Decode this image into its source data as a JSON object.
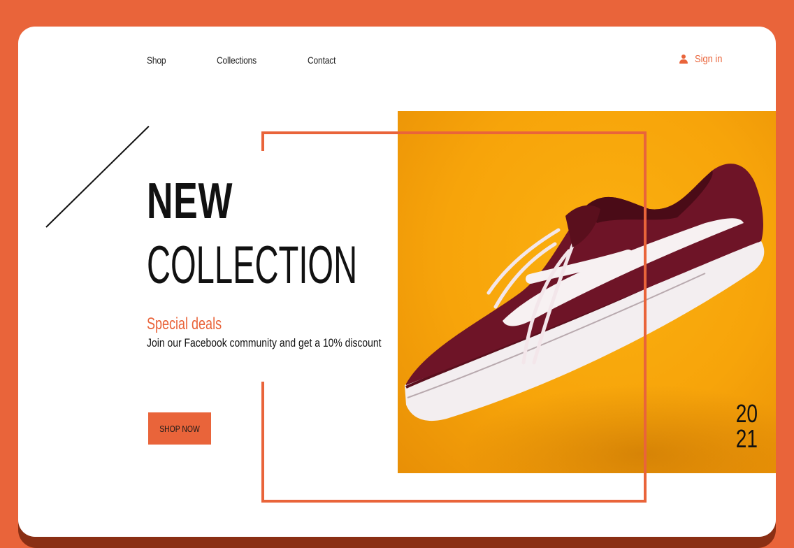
{
  "nav": {
    "items": [
      {
        "label": "Shop"
      },
      {
        "label": "Collections"
      },
      {
        "label": "Contact"
      }
    ],
    "signin_label": "Sign in"
  },
  "hero": {
    "title_line1": "NEW",
    "title_line2": "COLLECTION",
    "subtitle": "Special deals",
    "description": "Join our Facebook community and get a 10% discount",
    "cta_label": "SHOP NOW",
    "year_line1": "20",
    "year_line2": "21",
    "product_image": "sneaker-photo"
  },
  "colors": {
    "accent": "#e9643a",
    "photo_background": "#f7a40a",
    "text": "#111111",
    "card": "#ffffff"
  }
}
